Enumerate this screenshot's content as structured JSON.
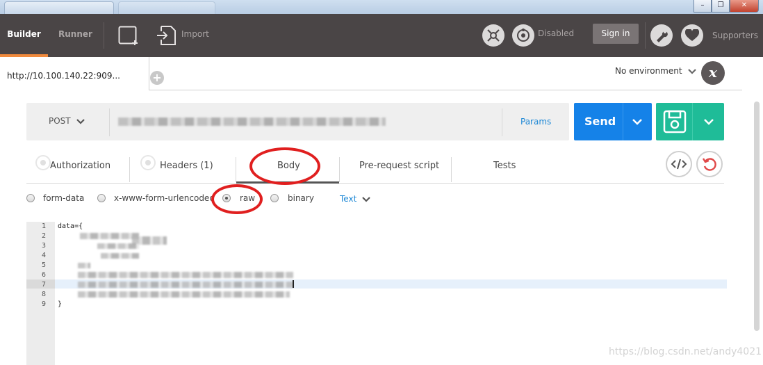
{
  "topbar": {
    "builder_label": "Builder",
    "runner_label": "Runner",
    "import_label": "Import",
    "disabled_label": "Disabled",
    "signin_label": "Sign in",
    "supporters_label": "Supporters",
    "accent_color": "#f08a3d"
  },
  "request_tab": {
    "title": "http://10.100.140.22:909..."
  },
  "environment": {
    "selected": "No environment",
    "icon_letter": "x"
  },
  "request": {
    "method": "POST",
    "params_label": "Params",
    "send_label": "Send",
    "send_color": "#1582e8",
    "save_color": "#1fbc98"
  },
  "subtabs": {
    "authorization": "Authorization",
    "headers": "Headers (1)",
    "body": "Body",
    "prerequest": "Pre-request script",
    "tests": "Tests"
  },
  "body_options": {
    "form_data": "form-data",
    "urlencoded": "x-www-form-urlencoded",
    "raw": "raw",
    "binary": "binary",
    "selected": "raw",
    "text_type": "Text"
  },
  "editor": {
    "line_numbers": [
      "1",
      "2",
      "3",
      "4",
      "5",
      "6",
      "7",
      "8",
      "9"
    ],
    "first_line": "data={",
    "last_line": "}"
  },
  "annotation_color": "#e01f1f",
  "watermark": "https://blog.csdn.net/andy4021"
}
